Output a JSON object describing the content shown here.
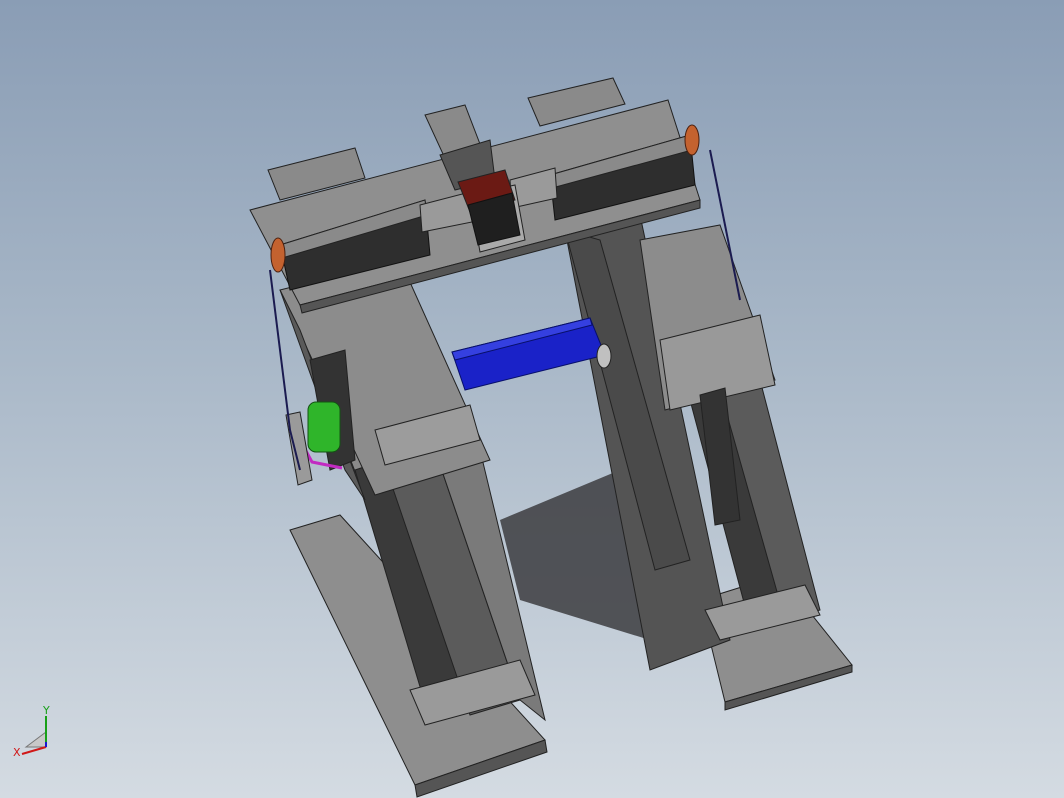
{
  "viewport": {
    "background_top": "#8a9db5",
    "background_bottom": "#d4dbe2"
  },
  "model": {
    "frame_color": "#8f8f8f",
    "dark_color": "#3a3a3a",
    "bar_color": "#1a22c8",
    "motor_color": "#6b1a14",
    "pulley_color": "#c4622f",
    "green_part_color": "#2fb52a",
    "magenta_part_color": "#c22bc2"
  },
  "triad": {
    "x_label": "X",
    "y_label": "Y",
    "x_color": "#d01818",
    "y_color": "#18a018",
    "z_color": "#1818d0"
  }
}
